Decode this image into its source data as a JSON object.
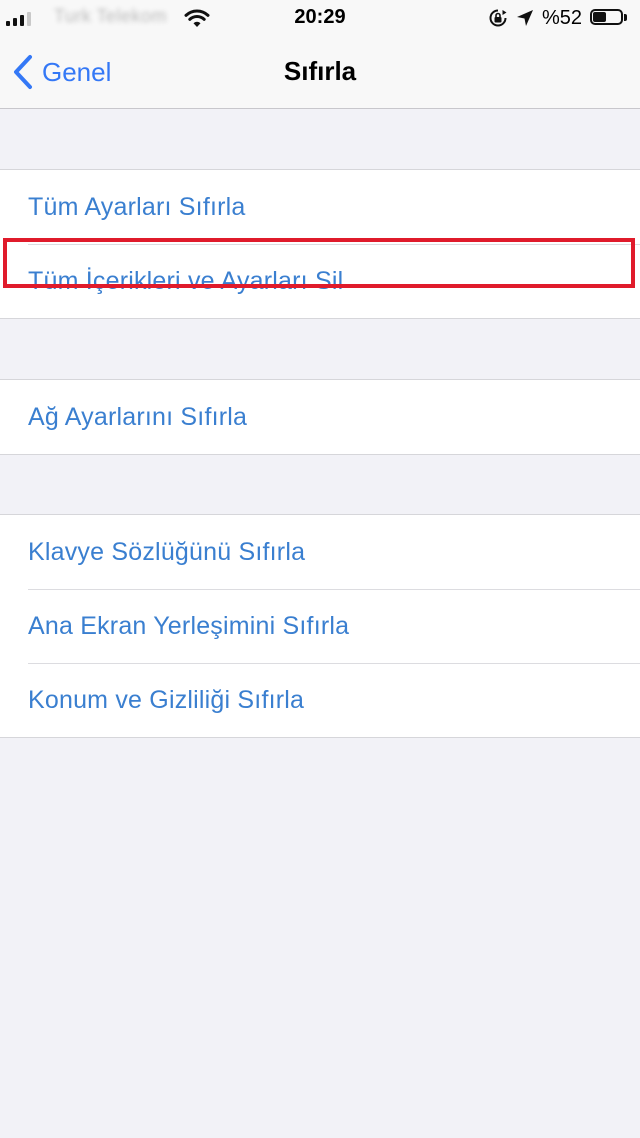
{
  "status_bar": {
    "carrier": "Turk Telekom",
    "time": "20:29",
    "battery_percent": "%52",
    "battery_level": 0.52
  },
  "nav": {
    "back_label": "Genel",
    "title": "Sıfırla"
  },
  "groups": [
    {
      "items": [
        {
          "label": "Tüm Ayarları Sıfırla"
        },
        {
          "label": "Tüm İçerikleri ve Ayarları Sil",
          "highlighted": true
        }
      ]
    },
    {
      "items": [
        {
          "label": "Ağ Ayarlarını Sıfırla"
        }
      ]
    },
    {
      "items": [
        {
          "label": "Klavye Sözlüğünü Sıfırla"
        },
        {
          "label": "Ana Ekran Yerleşimini Sıfırla"
        },
        {
          "label": "Konum ve Gizliliği Sıfırla"
        }
      ]
    }
  ],
  "colors": {
    "link_blue": "#3a7fd0",
    "nav_blue": "#3478f6",
    "highlight_red": "#e01b2b",
    "background": "#f2f2f7"
  },
  "icons": [
    "cellular-signal-icon",
    "wifi-icon",
    "orientation-lock-icon",
    "location-arrow-icon",
    "battery-icon",
    "chevron-left-icon"
  ]
}
